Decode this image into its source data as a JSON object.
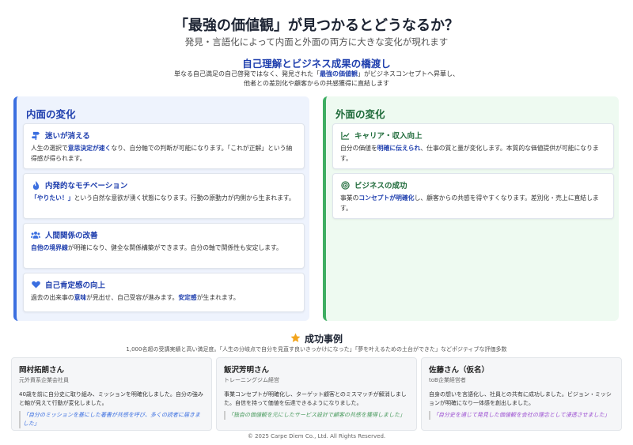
{
  "header": {
    "title": "「最強の価値観」が見つかるとどうなるか？",
    "subtitle": "発見・言語化によって内面と外面の両方に大きな変化が現れます"
  },
  "bridge": {
    "title": "自己理解とビジネス成果の橋渡し",
    "line1_a": "単なる自己満足の自己啓発ではなく、発見された「",
    "line1_hl": "最強の価値観",
    "line1_b": "」がビジネスコンセプトへ昇華し、",
    "line2": "他者との差別化や顧客からの共感獲得に直結します"
  },
  "inner": {
    "title": "内面の変化",
    "cards": [
      {
        "title": "迷いが消える",
        "a": "人生の選択で",
        "hl": "意思決定が速く",
        "b": "なり、自分軸での判断が可能になります。「これが正解」という納得感が得られます。"
      },
      {
        "title": "内発的なモチベーション",
        "a": "",
        "hl": "「やりたい！」",
        "b": "という自然な意欲が湧く状態になります。行動の原動力が内側から生まれます。"
      },
      {
        "title": "人間関係の改善",
        "a": "",
        "hl": "自他の境界線",
        "b": "が明確になり、健全な関係構築ができます。自分の軸で関係性も安定します。"
      },
      {
        "title": "自己肯定感の向上",
        "a": "過去の出来事の",
        "hl": "意味",
        "b": "が見出せ、自己受容が進みます。",
        "hl2": "安定感",
        "c": "が生まれます。"
      }
    ]
  },
  "outer": {
    "title": "外面の変化",
    "cards": [
      {
        "title": "キャリア・収入向上",
        "a": "自分の価値を",
        "hl": "明確に伝えられ",
        "b": "、仕事の質と量が変化します。本質的な価値提供が可能になります。"
      },
      {
        "title": "ビジネスの成功",
        "a": "事業の",
        "hl": "コンセプトが明確化",
        "b": "し、顧客からの共感を得やすくなります。差別化・売上に直結します。"
      }
    ]
  },
  "cases": {
    "title": "成功事例",
    "desc": "1,000名超の受講実績と高い満足度。「人生の分岐点で自分を見直す良いきっかけになった」「夢を叶えるための土台ができた」などポジティブな評価多数",
    "items": [
      {
        "name": "岡村拓朗さん",
        "role": "元外資系企業会社員",
        "text": "40歳を前に自分史に取り組み、ミッションを明確化しました。自分の強みと軸が見えて行動が変化しました。",
        "quote": "「自分のミッションを基にした著書が共感を呼び、多くの読者に届きました」"
      },
      {
        "name": "飯沢芳明さん",
        "role": "トレーニングジム経営",
        "text": "事業コンセプトが明確化し、ターゲット顧客とのミスマッチが解消しました。自信を持って価値を伝達できるようになりました。",
        "quote": "「独自の価値観を元にしたサービス設計で顧客の共感を獲得しました」"
      },
      {
        "name": "佐藤さん（仮名）",
        "role": "toB企業経営者",
        "text": "自身の想いを言語化し、社員との共有に成功しました。ビジョン・ミッションが明確になり一体感を創出しました。",
        "quote": "「自分史を通じて発見した価値観を会社の理念として浸透させました」"
      }
    ]
  },
  "footer": "© 2025 Carpe Diem Co., Ltd. All Rights Reserved.",
  "colors": {
    "blue": "#3b6fe0",
    "green": "#3fae63",
    "star": "#f2a41c"
  }
}
